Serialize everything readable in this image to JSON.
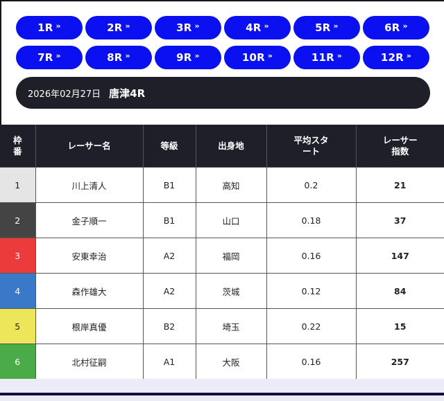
{
  "races": [
    {
      "label": "1R"
    },
    {
      "label": "2R"
    },
    {
      "label": "3R"
    },
    {
      "label": "4R"
    },
    {
      "label": "5R"
    },
    {
      "label": "6R"
    },
    {
      "label": "7R"
    },
    {
      "label": "8R"
    },
    {
      "label": "9R"
    },
    {
      "label": "10R"
    },
    {
      "label": "11R"
    },
    {
      "label": "12R"
    }
  ],
  "chevron": "»",
  "header": {
    "date": "2026年02月27日",
    "venue": "唐津4R"
  },
  "table": {
    "columns": {
      "frame": "枠番",
      "name": "レーサー名",
      "grade": "等級",
      "origin": "出身地",
      "start": "平均スタート",
      "index": "レーサー指数"
    },
    "rows": [
      {
        "frame": "1",
        "name": "川上清人",
        "grade": "B1",
        "origin": "高知",
        "start": "0.2",
        "index": "21",
        "color": "#e5e5e5",
        "text_color": "#222222"
      },
      {
        "frame": "2",
        "name": "金子順一",
        "grade": "B1",
        "origin": "山口",
        "start": "0.18",
        "index": "37",
        "color": "#444444",
        "text_color": "#ffffff"
      },
      {
        "frame": "3",
        "name": "安東幸治",
        "grade": "A2",
        "origin": "福岡",
        "start": "0.16",
        "index": "147",
        "color": "#ec3b3b",
        "text_color": "#ffffff"
      },
      {
        "frame": "4",
        "name": "森作雄大",
        "grade": "A2",
        "origin": "茨城",
        "start": "0.12",
        "index": "84",
        "color": "#3a78c8",
        "text_color": "#ffffff"
      },
      {
        "frame": "5",
        "name": "根岸真優",
        "grade": "B2",
        "origin": "埼玉",
        "start": "0.22",
        "index": "15",
        "color": "#eee65a",
        "text_color": "#222222"
      },
      {
        "frame": "6",
        "name": "北村征嗣",
        "grade": "A1",
        "origin": "大阪",
        "start": "0.16",
        "index": "257",
        "color": "#4aab48",
        "text_color": "#ffffff"
      }
    ]
  }
}
